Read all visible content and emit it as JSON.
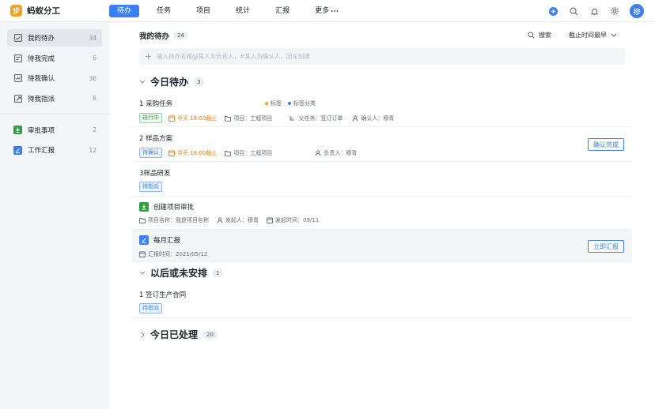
{
  "app": {
    "name": "蚂蚁分工",
    "logo_char": "步"
  },
  "nav": {
    "items": [
      "待办",
      "任务",
      "项目",
      "统计",
      "汇报"
    ],
    "more": "更多"
  },
  "user": {
    "avatar": "穆"
  },
  "sidebar": {
    "items": [
      {
        "label": "我的待办",
        "count": "34",
        "icon": "checkbox-icon"
      },
      {
        "label": "待我完成",
        "count": "6",
        "icon": "list-icon"
      },
      {
        "label": "待我确认",
        "count": "36",
        "icon": "confirm-icon"
      },
      {
        "label": "待我指派",
        "count": "6",
        "icon": "assign-icon"
      }
    ],
    "apps": [
      {
        "label": "审批事项",
        "count": "2",
        "icon": "download-icon",
        "color": "#2ea043"
      },
      {
        "label": "工作汇报",
        "count": "12",
        "icon": "edit-icon",
        "color": "#3b7ff5"
      }
    ]
  },
  "main": {
    "title": "我的待办",
    "count": "24",
    "search_label": "搜索",
    "sort_label": "截止时间最早",
    "input_placeholder": "输入待办名称@某人为负责人，#某人为确认人，回车创建"
  },
  "sections": {
    "today": {
      "title": "今日待办",
      "count": "3"
    },
    "later": {
      "title": "以后或未安排",
      "count": "1"
    },
    "done": {
      "title": "今日已处理",
      "count": "20"
    }
  },
  "tasks": {
    "t1": {
      "title": "1 采购任务",
      "status": "进行中",
      "due": "今天 18:00截止",
      "project": "项目：工程项目",
      "parent": "父任务：签订订单",
      "confirmer": "确认人：穆青",
      "label1": "标签",
      "label2": "标签分类",
      "label1_color": "#f5a020",
      "label2_color": "#3b7ff5"
    },
    "t2": {
      "title": "2 样品方案",
      "status": "待确认",
      "due": "今天 18:00截止",
      "project": "项目：工程项目",
      "owner": "负责人：穆青",
      "action": "确认完成"
    },
    "t3": {
      "title": "3样品研发",
      "status": "待指派"
    },
    "t4": {
      "title": "创建项目审批",
      "project_name": "项目名称：我是项目名称",
      "initiator": "发起人：穆青",
      "time": "发起时间：09/11"
    },
    "t5": {
      "title": "每月汇报",
      "report_time": "汇报时间：2021/05/12",
      "action": "立即汇报"
    },
    "t6": {
      "title": "1 签订生产合同",
      "status": "待指派"
    }
  },
  "colors": {
    "accent": "#3b7ff5",
    "orange": "#f07b16",
    "green": "#2ea043"
  }
}
